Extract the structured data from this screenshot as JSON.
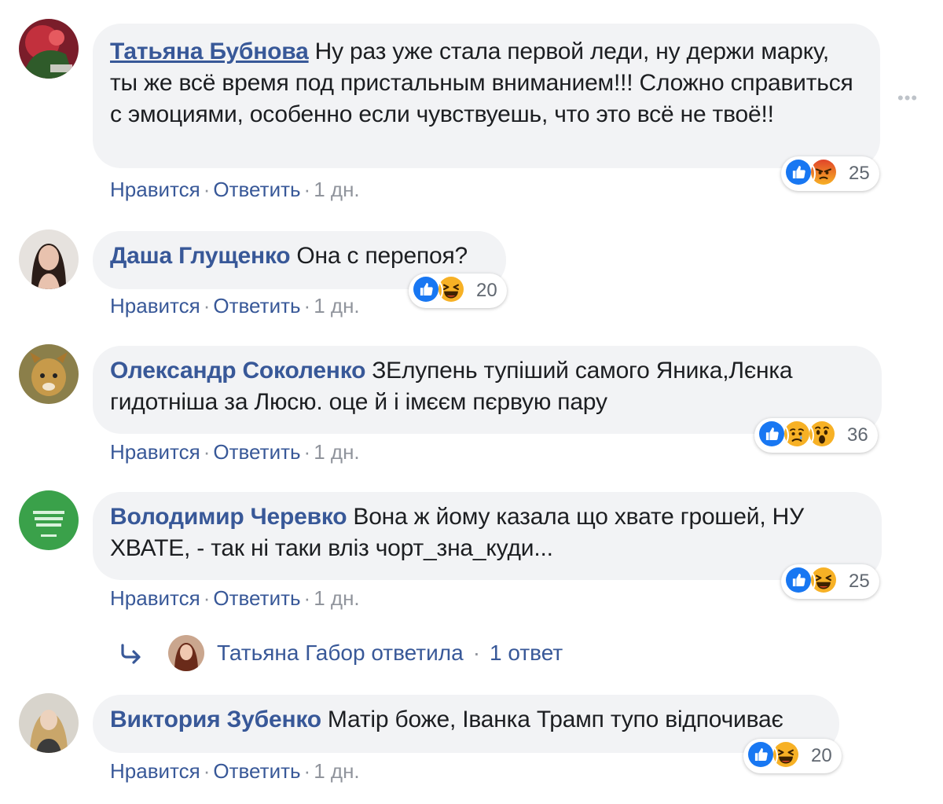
{
  "colors": {
    "link": "#385898",
    "bubble_bg": "#f2f3f5",
    "meta_gray": "#90949c",
    "like_blue": "#1877f2",
    "reaction_yellow": "#f7b125",
    "angry_orange": "#e9710f"
  },
  "actions": {
    "like": "Нравится",
    "reply": "Ответить",
    "separator": "·"
  },
  "more_menu": "•••",
  "comments": [
    {
      "author": "Татьяна Бубнова",
      "text": "Ну раз уже стала первой леди, ну держи марку, ты же всё время под пристальным вниманием!!! Сложно справиться с эмоциями, особенно если чувствуешь, что это всё не твоё!!",
      "time": "1 дн.",
      "reactions": [
        "like-icon",
        "angry-icon"
      ],
      "reaction_count": "25"
    },
    {
      "author": "Даша Глущенко",
      "text": "Она с перепоя?",
      "time": "1 дн.",
      "reactions": [
        "like-icon",
        "haha-icon"
      ],
      "reaction_count": "20"
    },
    {
      "author": "Олександр Соколенко",
      "text": "ЗЕлупень тупіший самого Яника,Лєнка гидотніша за Люсю. оце й і імєєм пєрвую пару",
      "time": "1 дн.",
      "reactions": [
        "like-icon",
        "sad-icon",
        "wow-icon"
      ],
      "reaction_count": "36"
    },
    {
      "author": "Володимир Черевко",
      "text": "Вона ж йому казала що хвате грошей, НУ ХВАТЕ, - так ні таки вліз чорт_зна_куди...",
      "time": "1 дн.",
      "reactions": [
        "like-icon",
        "haha-icon"
      ],
      "reaction_count": "25"
    },
    {
      "author": "Виктория Зубенко",
      "text": "Матір боже, Іванка Трамп тупо відпочиває",
      "time": "1 дн.",
      "reactions": [
        "like-icon",
        "haha-icon"
      ],
      "reaction_count": "20"
    }
  ],
  "reply_summary": {
    "text": "Татьяна Габор ответила",
    "count": "1 ответ"
  }
}
